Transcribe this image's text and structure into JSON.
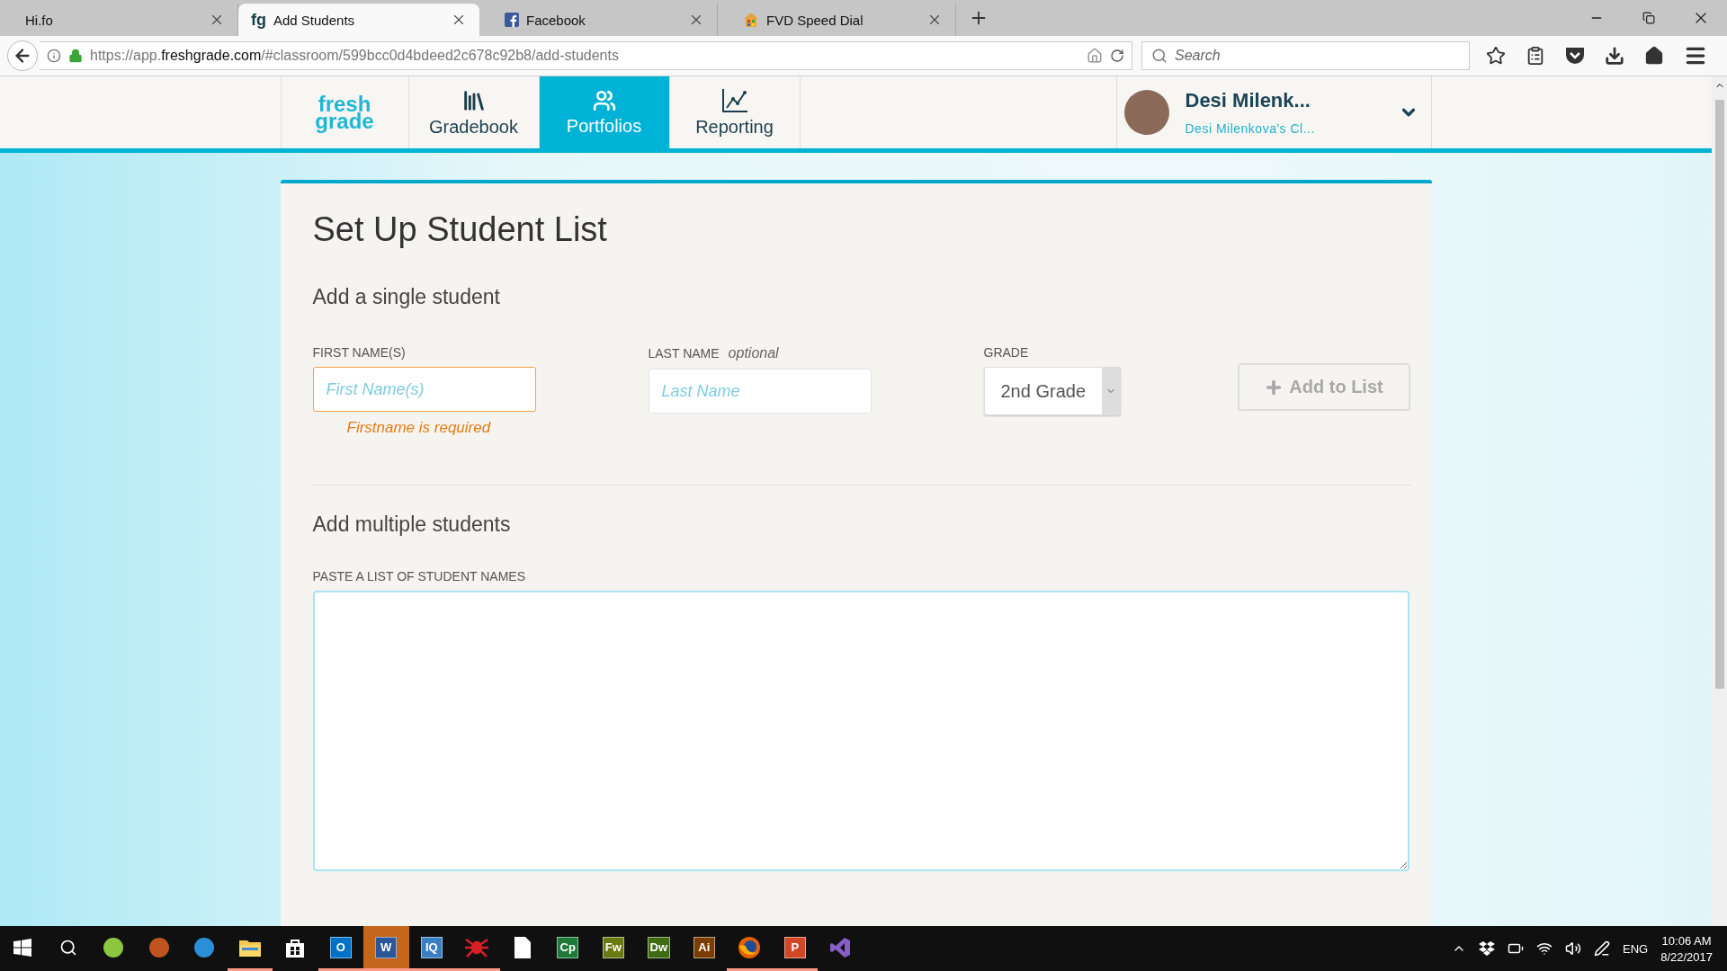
{
  "browser": {
    "tabs": [
      {
        "title": "Hi.fo",
        "kind": "none",
        "selected": false
      },
      {
        "title": "Add Students",
        "kind": "text",
        "favicon_text": "fg",
        "selected": true
      },
      {
        "title": "Facebook",
        "kind": "facebook",
        "selected": false
      },
      {
        "title": "FVD Speed Dial",
        "kind": "house",
        "selected": false
      }
    ],
    "url": {
      "prefix": "https://app.",
      "domain": "freshgrade.com",
      "path": "/#classroom/599bcc0d4bdeed2c678c92b8/add-students"
    },
    "search": {
      "placeholder": "Search"
    }
  },
  "app": {
    "logo": {
      "top": "fresh",
      "bottom": "grade"
    },
    "nav": [
      {
        "label": "Gradebook",
        "kind": "books",
        "selected": false
      },
      {
        "label": "Portfolios",
        "kind": "people",
        "selected": true
      },
      {
        "label": "Reporting",
        "kind": "chart",
        "selected": false
      }
    ],
    "user": {
      "name": "Desi Milenk...",
      "class": "Desi Milenkova's Cl..."
    }
  },
  "form": {
    "title": "Set Up Student List",
    "single": {
      "heading": "Add a single student",
      "first": {
        "label": "FIRST NAME(S)",
        "placeholder": "First Name(s)",
        "invalid": true,
        "error": "Firstname is required"
      },
      "last": {
        "label": "LAST NAME",
        "hint": "optional",
        "placeholder": "Last Name"
      },
      "grade": {
        "label": "GRADE",
        "value": "2nd Grade"
      },
      "button": {
        "label": "Add to List",
        "disabled": true
      }
    },
    "multiple": {
      "heading": "Add multiple students",
      "label": "PASTE A LIST OF STUDENT NAMES",
      "focused": true
    }
  },
  "taskbar": {
    "items": [
      {
        "kind": "start",
        "running": false,
        "selected": false
      },
      {
        "kind": "search",
        "running": false,
        "selected": false
      },
      {
        "kind": "round",
        "color": "#8cc63f",
        "running": false,
        "selected": false
      },
      {
        "kind": "round",
        "color": "#c0541e",
        "running": false,
        "selected": false
      },
      {
        "kind": "round",
        "color": "#2a8fd6",
        "running": false,
        "selected": false
      },
      {
        "kind": "folder",
        "running": true,
        "selected": false
      },
      {
        "kind": "store",
        "running": false,
        "selected": false
      },
      {
        "kind": "tile",
        "label": "O",
        "color": "#0072c6",
        "running": true,
        "selected": false
      },
      {
        "kind": "tile",
        "label": "W",
        "color": "#2b579a",
        "running": true,
        "selected": true
      },
      {
        "kind": "tile",
        "label": "IQ",
        "color": "#3a7fc1",
        "running": true,
        "selected": false
      },
      {
        "kind": "spider",
        "running": true,
        "selected": false
      },
      {
        "kind": "page",
        "running": false,
        "selected": false
      },
      {
        "kind": "tile",
        "label": "Cp",
        "color": "#1f7a3a",
        "running": false,
        "selected": false
      },
      {
        "kind": "tile",
        "label": "Fw",
        "color": "#6a7a10",
        "running": false,
        "selected": false
      },
      {
        "kind": "tile",
        "label": "Dw",
        "color": "#3f6b12",
        "running": false,
        "selected": false
      },
      {
        "kind": "tile",
        "label": "Ai",
        "color": "#7a3f00",
        "running": false,
        "selected": false
      },
      {
        "kind": "firefox",
        "running": true,
        "selected": false
      },
      {
        "kind": "tile",
        "label": "P",
        "color": "#d24726",
        "running": true,
        "selected": false
      },
      {
        "kind": "vs",
        "running": false,
        "selected": false
      }
    ],
    "language": "ENG",
    "time": "10:06 AM",
    "date": "8/22/2017"
  }
}
